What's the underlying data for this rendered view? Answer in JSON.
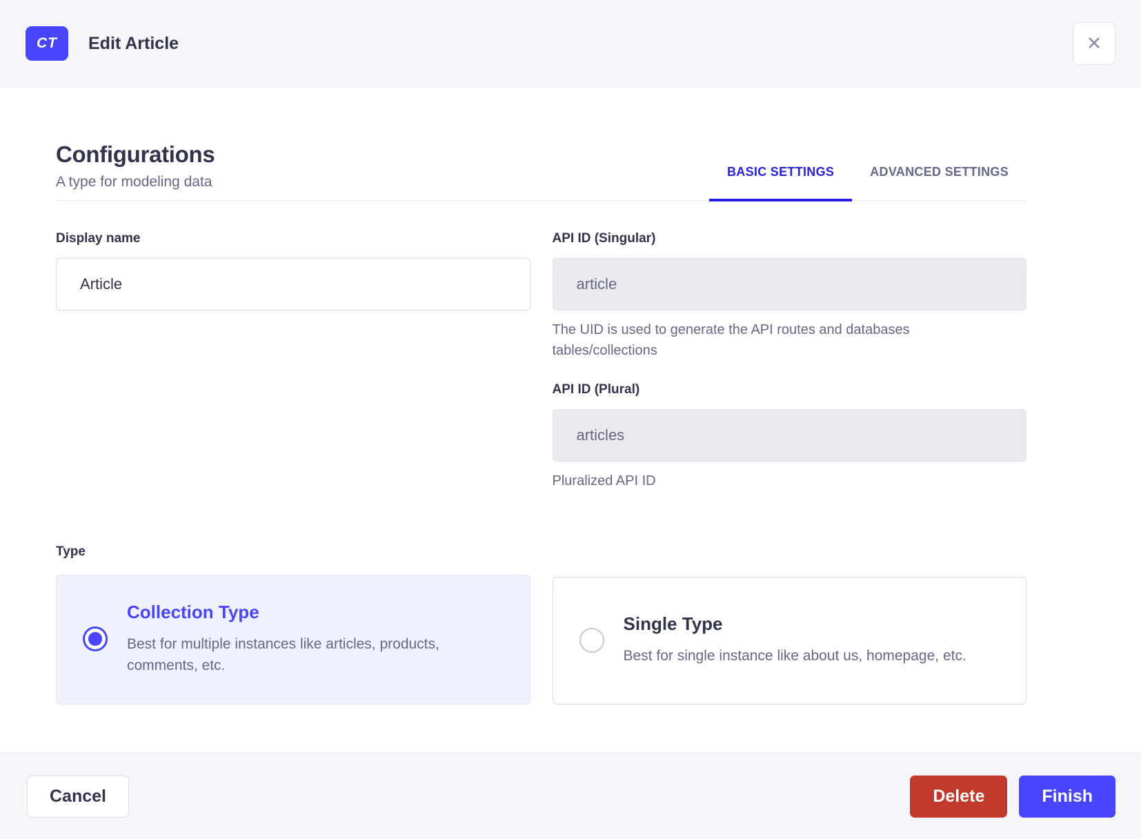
{
  "colors": {
    "primary": "#4945FF",
    "tab_active": "#271FE0",
    "danger": "#C23A2B",
    "selected_card_bg": "#F0F0FF",
    "surface_gray": "#F6F6F9",
    "text_primary": "#32324D",
    "text_secondary": "#666687"
  },
  "header": {
    "badge_label": "CT",
    "title": "Edit Article",
    "close_icon": "✕"
  },
  "config": {
    "title": "Configurations",
    "subtitle": "A type for modeling data"
  },
  "tabs": [
    {
      "label": "BASIC SETTINGS",
      "active": true
    },
    {
      "label": "ADVANCED SETTINGS",
      "active": false
    }
  ],
  "fields": {
    "display_name": {
      "label": "Display name",
      "value": "Article"
    },
    "api_id_singular": {
      "label": "API ID (Singular)",
      "value": "article",
      "hint": "The UID is used to generate the API routes and databases tables/collections"
    },
    "api_id_plural": {
      "label": "API ID (Plural)",
      "value": "articles",
      "hint": "Pluralized API ID"
    }
  },
  "type_section": {
    "label": "Type",
    "options": [
      {
        "title": "Collection Type",
        "description": "Best for multiple instances like articles, products, comments, etc.",
        "selected": true
      },
      {
        "title": "Single Type",
        "description": "Best for single instance like about us, homepage, etc.",
        "selected": false
      }
    ]
  },
  "footer": {
    "cancel_label": "Cancel",
    "delete_label": "Delete",
    "finish_label": "Finish"
  }
}
